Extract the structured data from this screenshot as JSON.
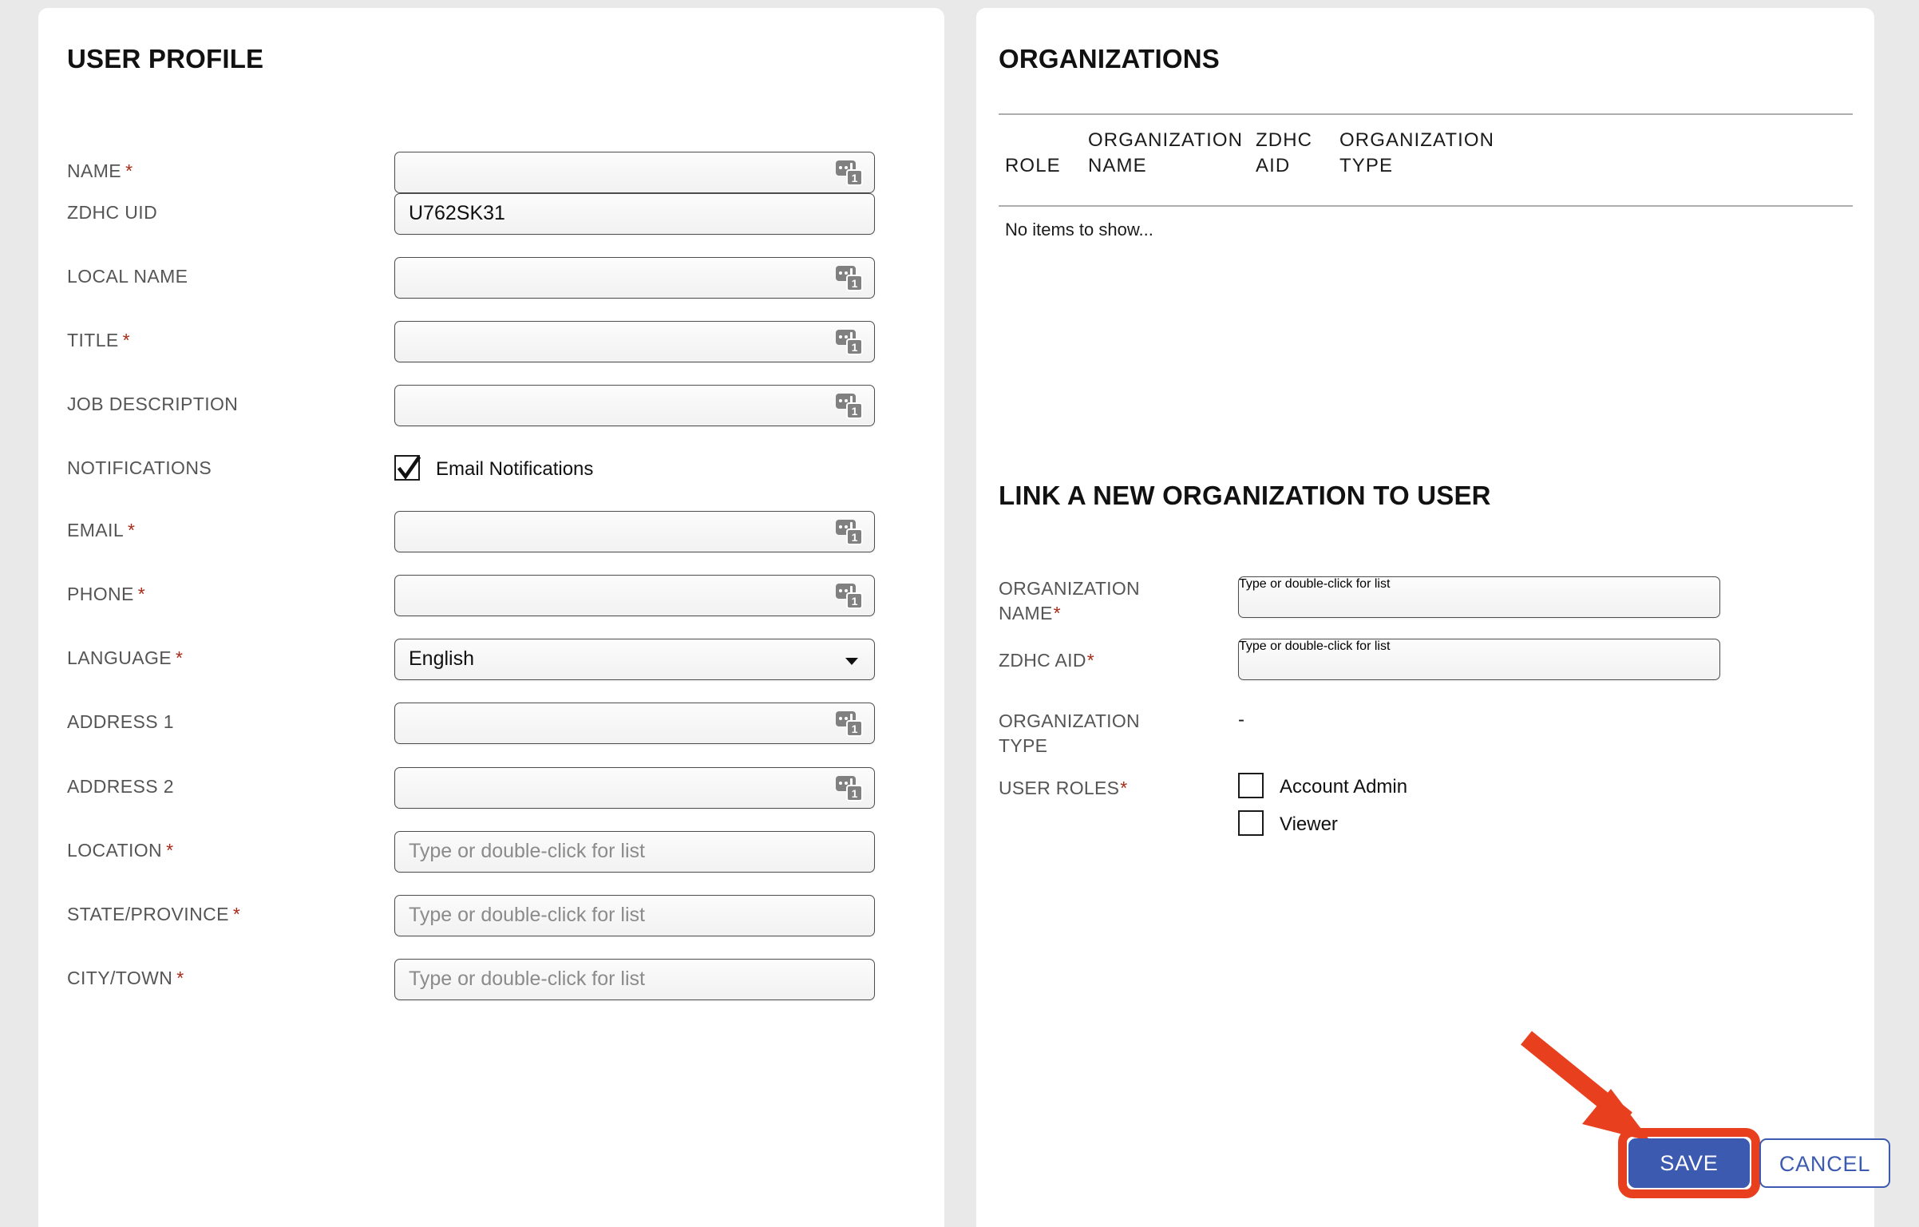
{
  "colors": {
    "background": "#e9e9e9",
    "panel": "#ffffff",
    "required_asterisk": "#a92a16",
    "accent_blue": "#3c5bb0",
    "annotation_red": "#e8401f",
    "label_gray": "#555555",
    "placeholder_gray": "#8b8b8b"
  },
  "left_panel": {
    "title": "USER PROFILE",
    "fields": [
      {
        "label": "NAME",
        "required": true,
        "type": "text-lang",
        "value": "",
        "placeholder": ""
      },
      {
        "label": "ZDHC UID",
        "required": false,
        "type": "text",
        "value": "U762SK31",
        "placeholder": ""
      },
      {
        "label": "LOCAL NAME",
        "required": false,
        "type": "text-lang",
        "value": "",
        "placeholder": ""
      },
      {
        "label": "TITLE",
        "required": true,
        "type": "text-lang",
        "value": "",
        "placeholder": ""
      },
      {
        "label": "JOB DESCRIPTION",
        "required": false,
        "type": "text-lang",
        "value": "",
        "placeholder": ""
      },
      {
        "label": "NOTIFICATIONS",
        "required": false,
        "type": "checkbox",
        "checkbox_label": "Email Notifications",
        "checked": true
      },
      {
        "label": "EMAIL",
        "required": true,
        "type": "text-lang",
        "value": "",
        "placeholder": ""
      },
      {
        "label": "PHONE",
        "required": true,
        "type": "text-lang",
        "value": "",
        "placeholder": ""
      },
      {
        "label": "LANGUAGE",
        "required": true,
        "type": "select",
        "value": "English",
        "placeholder": ""
      },
      {
        "label": "ADDRESS 1",
        "required": false,
        "type": "text-lang",
        "value": "",
        "placeholder": ""
      },
      {
        "label": "ADDRESS 2",
        "required": false,
        "type": "text-lang",
        "value": "",
        "placeholder": ""
      },
      {
        "label": "LOCATION",
        "required": true,
        "type": "lookup",
        "value": "",
        "placeholder": "Type or double-click for list"
      },
      {
        "label": "STATE/PROVINCE",
        "required": true,
        "type": "lookup",
        "value": "",
        "placeholder": "Type or double-click for list"
      },
      {
        "label": "CITY/TOWN",
        "required": true,
        "type": "lookup",
        "value": "",
        "placeholder": "Type or double-click for list"
      }
    ],
    "icons": {
      "lang_badge_count": "1",
      "lang_badge_name": "translation-badge-icon"
    }
  },
  "right_panel": {
    "organizations": {
      "title": "ORGANIZATIONS",
      "columns": [
        "ROLE",
        "ORGANIZATION\nNAME",
        "ZDHC\nAID",
        "ORGANIZATION\nTYPE"
      ],
      "rows": [],
      "empty_message": "No items to show..."
    },
    "link_organization": {
      "title": "LINK A NEW ORGANIZATION TO USER",
      "fields": [
        {
          "label": "ORGANIZATION\nNAME",
          "required": true,
          "type": "lookup",
          "value": "",
          "placeholder": "Type or double-click for list"
        },
        {
          "label": "ZDHC AID",
          "required": true,
          "type": "lookup",
          "value": "",
          "placeholder": "Type or double-click for list"
        },
        {
          "label": "ORGANIZATION\nTYPE",
          "required": false,
          "type": "static",
          "value": "-"
        }
      ],
      "user_roles": {
        "label": "USER ROLES",
        "required": true,
        "options": [
          {
            "label": "Account Admin",
            "checked": false
          },
          {
            "label": "Viewer",
            "checked": false
          }
        ]
      }
    },
    "actions": {
      "save_label": "SAVE",
      "cancel_label": "CANCEL"
    }
  }
}
